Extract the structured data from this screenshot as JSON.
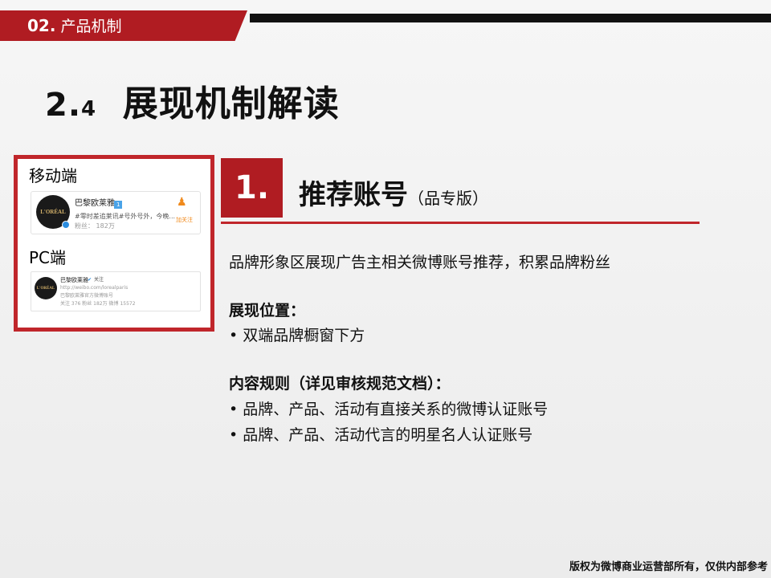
{
  "header": {
    "section_num": "02.",
    "section_name": "产品机制"
  },
  "title": {
    "num_major": "2.",
    "num_minor": "4",
    "text": "展现机制解读"
  },
  "preview": {
    "mobile_label": "移动端",
    "pc_label": "PC端",
    "mobile_card": {
      "name": "巴黎欧莱雅",
      "badge": "1",
      "desc": "#零时差追莱讯#号外号外，今晚...",
      "fans_label": "粉丝",
      "fans_value": "182万",
      "follow_label": "加关注",
      "logo_text": "L'ORÉAL"
    },
    "pc_card": {
      "name": "巴黎欧莱雅",
      "tag": "关注",
      "url": "http://weibo.com/lorealparis",
      "desc": "巴黎欧莱雅官方微博账号",
      "stats": "关注 376   粉丝 182万   微博 15572",
      "logo_text": "L'ORÉAL"
    }
  },
  "section": {
    "num": "1.",
    "title": "推荐账号",
    "subtitle": "（品专版）"
  },
  "body": {
    "intro": "品牌形象区展现广告主相关微博账号推荐，积累品牌粉丝",
    "position_heading": "展现位置：",
    "position_items": [
      "• 双端品牌橱窗下方"
    ],
    "rules_heading": "内容规则（详见审核规范文档）：",
    "rules_items": [
      "• 品牌、产品、活动有直接关系的微博认证账号",
      "• 品牌、产品、活动代言的明星名人认证账号"
    ]
  },
  "footer": "版权为微博商业运营部所有，仅供内部参考",
  "colors": {
    "accent_red": "#b01c22",
    "frame_red": "#c0262b",
    "header_bar": "#111111"
  }
}
